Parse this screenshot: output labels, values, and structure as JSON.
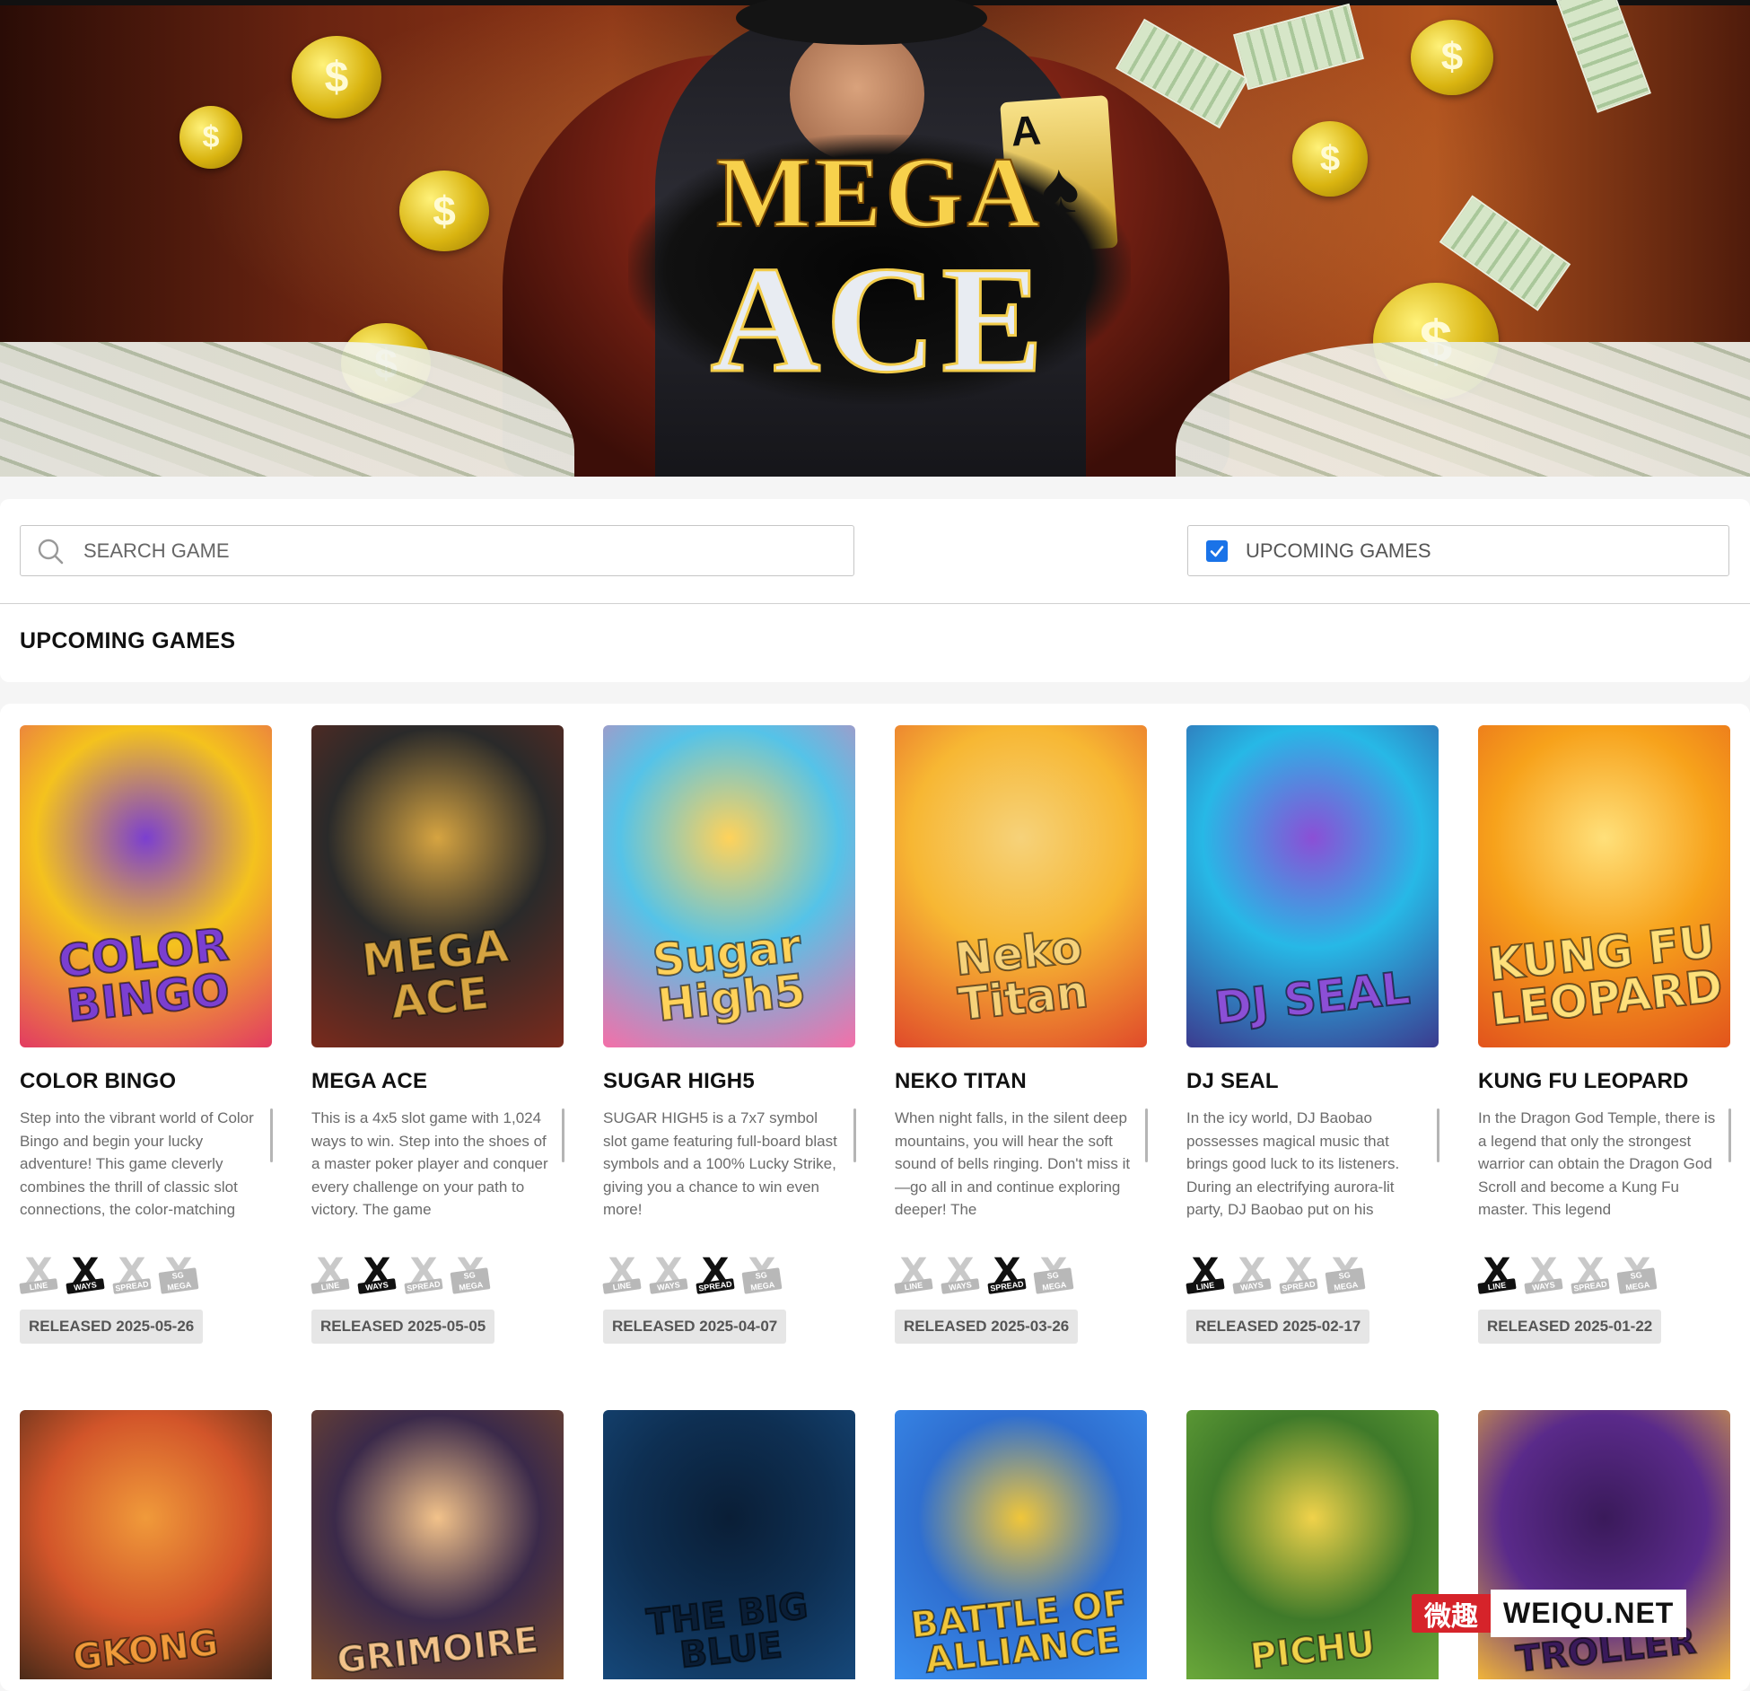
{
  "hero": {
    "logo_line1": "MEGA",
    "logo_line2": "ACE",
    "card_rank": "A"
  },
  "search": {
    "placeholder": "SEARCH GAME"
  },
  "filter": {
    "upcoming_label": "UPCOMING GAMES",
    "upcoming_checked": true
  },
  "section": {
    "title": "UPCOMING GAMES"
  },
  "way_labels": [
    "LINE",
    "WAYS",
    "SPREAD",
    "SG MEGA"
  ],
  "games": [
    {
      "title": "COLOR BINGO",
      "art_text": "COLOR BINGO",
      "art_colors": [
        "#f4c21e",
        "#e23b62",
        "#7b3fd0"
      ],
      "description": "Step into the vibrant world of Color Bingo and begin your lucky adventure! This game cleverly combines the thrill of classic slot connections, the color-matching",
      "active_way": "WAYS",
      "released": "RELEASED 2025-05-26"
    },
    {
      "title": "MEGA ACE",
      "art_text": "MEGA ACE",
      "art_colors": [
        "#2a2a2a",
        "#7a2a1c",
        "#d6a441"
      ],
      "description": "This is a 4x5 slot game with 1,024 ways to win. Step into the shoes of a master poker player and conquer every challenge on your path to victory. The game",
      "active_way": "WAYS",
      "released": "RELEASED 2025-05-05"
    },
    {
      "title": "SUGAR HIGH5",
      "art_text": "Sugar High5",
      "art_colors": [
        "#55c3e8",
        "#f46fa8",
        "#ffd25a"
      ],
      "description": "SUGAR HIGH5 is a 7x7 symbol slot game featuring full-board blast symbols and a 100% Lucky Strike, giving you a chance to win even more!",
      "active_way": "SPREAD",
      "released": "RELEASED 2025-04-07"
    },
    {
      "title": "NEKO TITAN",
      "art_text": "Neko Titan",
      "art_colors": [
        "#f7b733",
        "#e04a2a",
        "#f6d27a"
      ],
      "description": "When night falls, in the silent deep mountains, you will hear the soft sound of bells ringing. Don't miss it—go all in and continue exploring deeper! The",
      "active_way": "SPREAD",
      "released": "RELEASED 2025-03-26"
    },
    {
      "title": "DJ SEAL",
      "art_text": "DJ SEAL",
      "art_colors": [
        "#27b8e6",
        "#3b3b8f",
        "#8b4fd6"
      ],
      "description": "In the icy world, DJ Baobao possesses magical music that brings good luck to its listeners. During an electrifying aurora-lit party, DJ Baobao put on his",
      "active_way": "LINE",
      "released": "RELEASED 2025-02-17"
    },
    {
      "title": "KUNG FU LEOPARD",
      "art_text": "KUNG FU LEOPARD",
      "art_colors": [
        "#f7a21b",
        "#e2541c",
        "#ffe07a"
      ],
      "description": "In the Dragon God Temple, there is a legend that only the strongest warrior can obtain the Dragon God Scroll and become a Kung Fu master. This legend",
      "active_way": "LINE",
      "released": "RELEASED 2025-01-22"
    }
  ],
  "games_row2": [
    {
      "art_text": "GKONG",
      "art_colors": [
        "#d2552a",
        "#4a2a18",
        "#f09a3a"
      ]
    },
    {
      "art_text": "GRIMOIRE",
      "art_colors": [
        "#3b2a4a",
        "#7a4a2a",
        "#f2c28a"
      ]
    },
    {
      "art_text": "THE BIG BLUE",
      "art_colors": [
        "#0e2f52",
        "#16487a",
        "#0a1e36"
      ]
    },
    {
      "art_text": "BATTLE OF ALLIANCE",
      "art_colors": [
        "#2f6fd0",
        "#3a8ff0",
        "#f0c63a"
      ]
    },
    {
      "art_text": "PICHU",
      "art_colors": [
        "#3f7a2a",
        "#6aa83a",
        "#f0d24a"
      ]
    },
    {
      "art_text": "TOWN TROLLER",
      "art_colors": [
        "#5a2a8a",
        "#f0b43a",
        "#3a1a5a"
      ]
    }
  ],
  "watermark": {
    "cn": "微趣",
    "en": "WEIQU.NET"
  }
}
